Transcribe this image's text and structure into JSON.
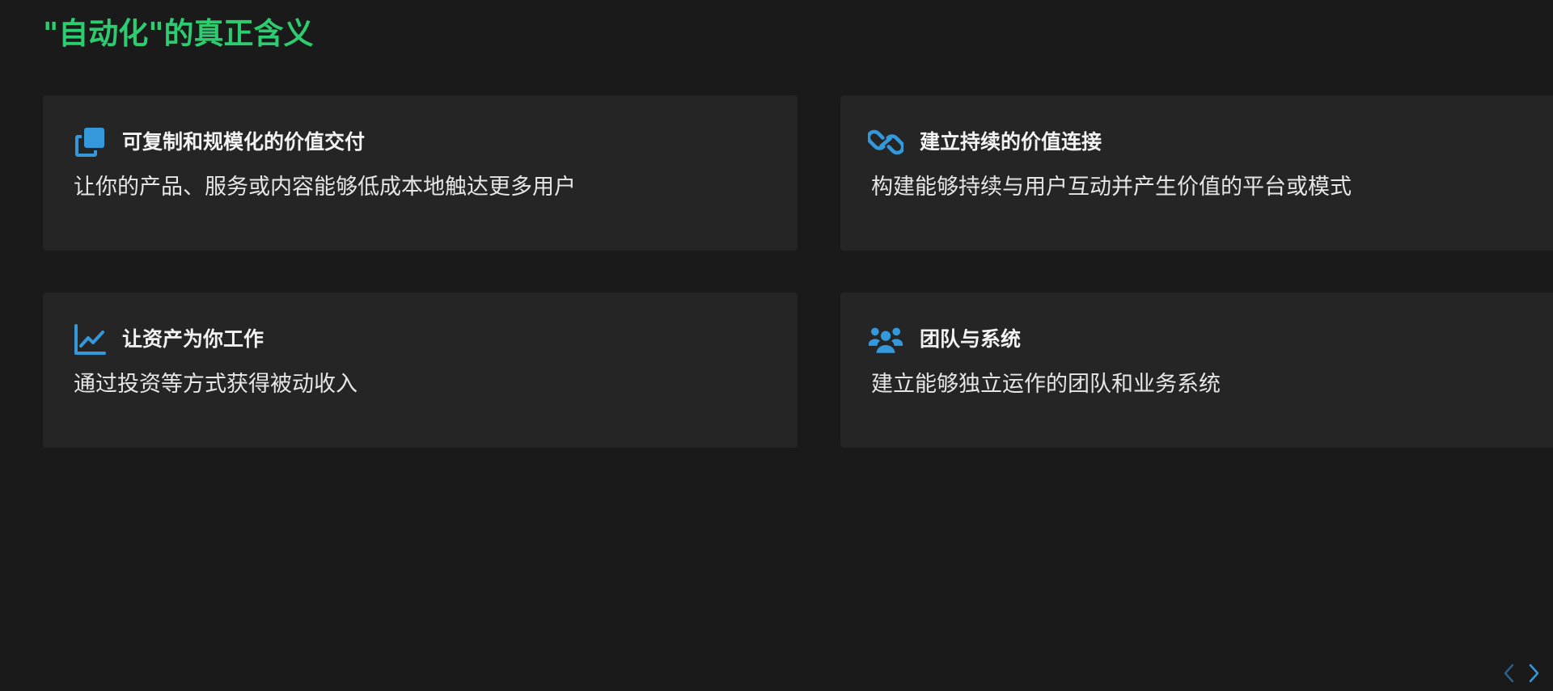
{
  "heading": "\"自动化\"的真正含义",
  "colors": {
    "accent_green": "#2ecc71",
    "icon_blue": "#3498db",
    "card_bg": "#252525",
    "page_bg": "#1a1a1a"
  },
  "cards": [
    {
      "icon": "clone-icon",
      "title": "可复制和规模化的价值交付",
      "description": "让你的产品、服务或内容能够低成本地触达更多用户"
    },
    {
      "icon": "link-icon",
      "title": "建立持续的价值连接",
      "description": "构建能够持续与用户互动并产生价值的平台或模式"
    },
    {
      "icon": "chart-line-icon",
      "title": "让资产为你工作",
      "description": "通过投资等方式获得被动收入"
    },
    {
      "icon": "users-icon",
      "title": "团队与系统",
      "description": "建立能够独立运作的团队和业务系统"
    }
  ],
  "nav": {
    "prev_icon": "chevron-left-icon",
    "next_icon": "chevron-right-icon"
  }
}
